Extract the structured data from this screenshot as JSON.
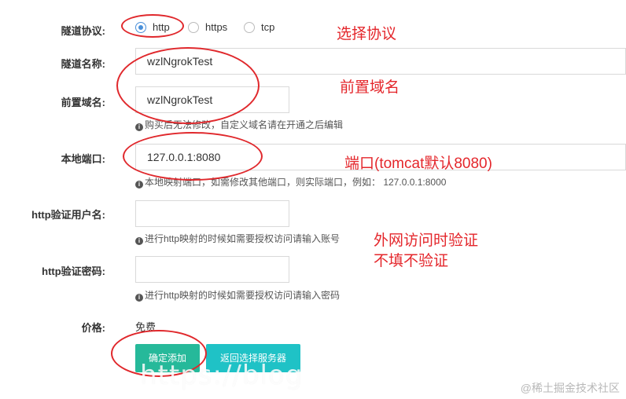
{
  "form": {
    "protocol": {
      "label": "隧道协议:",
      "options": [
        "http",
        "https",
        "tcp"
      ],
      "selected": "http"
    },
    "tunnel_name": {
      "label": "隧道名称:",
      "value": "wzlNgrokTest"
    },
    "domain": {
      "label": "前置域名:",
      "value": "wzlNgrokTest",
      "help": "购买后无法修改，自定义域名请在开通之后编辑"
    },
    "local_port": {
      "label": "本地端口:",
      "value": "127.0.0.1:8080",
      "help": "本地映射端口，如需修改其他端口，则实际端口，例如： 127.0.0.1:8000"
    },
    "http_user": {
      "label": "http验证用户名:",
      "value": "",
      "help": "进行http映射的时候如需要授权访问请输入账号"
    },
    "http_pass": {
      "label": "http验证密码:",
      "value": "",
      "help": "进行http映射的时候如需要授权访问请输入密码"
    },
    "price": {
      "label": "价格:",
      "value": "免费"
    },
    "buttons": {
      "confirm": "确定添加",
      "back": "返回选择服务器"
    }
  },
  "annotations": {
    "protocol_note": "选择协议",
    "domain_note": "前置域名",
    "port_note": "端口(tomcat默认8080)",
    "auth_note_line1": "外网访问时验证",
    "auth_note_line2": "不填不验证"
  },
  "overlay": {
    "watermark": "https://blog",
    "site_credit": "@稀土掘金技术社区"
  },
  "colors": {
    "annotation_red": "#e4262b",
    "confirm_button": "#26b99a",
    "back_button": "#1fc2c6",
    "radio_checked": "#4a90d9"
  }
}
